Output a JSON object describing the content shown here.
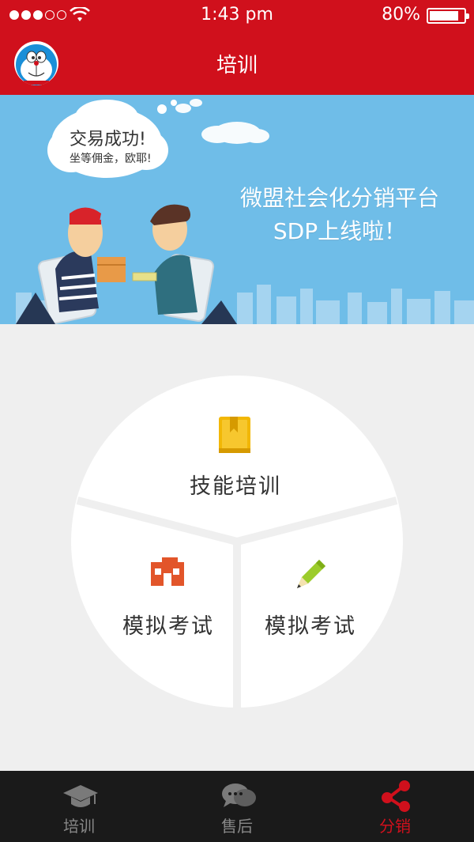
{
  "status_bar": {
    "time": "1:43 pm",
    "battery": "80%"
  },
  "header": {
    "title": "培训"
  },
  "banner": {
    "bubble_line1": "交易成功!",
    "bubble_line2": "坐等佣金，欧耶!",
    "headline_line1": "微盟社会化分销平台",
    "headline_line2": "SDP上线啦！"
  },
  "menu": {
    "top": {
      "label": "技能培训",
      "icon": "book-icon"
    },
    "bottom_left": {
      "label": "模拟考试",
      "icon": "building-icon"
    },
    "bottom_right": {
      "label": "模拟考试",
      "icon": "pencil-icon"
    }
  },
  "tabbar": {
    "tabs": [
      {
        "label": "培训",
        "icon": "graduation-cap-icon"
      },
      {
        "label": "售后",
        "icon": "chat-bubbles-icon"
      },
      {
        "label": "分销",
        "icon": "share-icon"
      }
    ],
    "active_index": 2
  },
  "colors": {
    "primary": "#d0101c",
    "banner_bg": "#6fbde8",
    "book": "#f2b705",
    "building": "#e2552a",
    "pencil": "#9ccc2b"
  }
}
